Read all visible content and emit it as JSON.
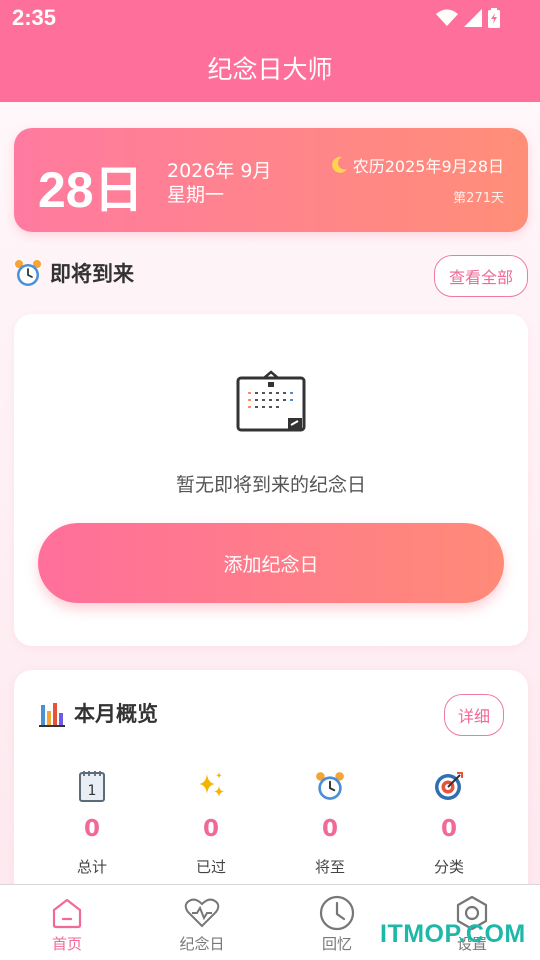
{
  "status_bar": {
    "time": "2:35"
  },
  "header": {
    "title": "纪念日大师"
  },
  "date_card": {
    "day": "28日",
    "year_month": "2026年 9月",
    "weekday": "星期一",
    "lunar": "农历2025年9月28日",
    "day_of_year": "第271天"
  },
  "upcoming": {
    "title": "即将到来",
    "view_all": "查看全部",
    "empty_text": "暂无即将到来的纪念日",
    "add_button": "添加纪念日"
  },
  "overview": {
    "title": "本月概览",
    "detail_button": "详细",
    "stats": [
      {
        "icon": "calendar-icon",
        "value": "0",
        "label": "总计"
      },
      {
        "icon": "sparkle-icon",
        "value": "0",
        "label": "已过"
      },
      {
        "icon": "alarm-clock-icon",
        "value": "0",
        "label": "将至"
      },
      {
        "icon": "target-icon",
        "value": "0",
        "label": "分类"
      }
    ]
  },
  "bottom_nav": [
    {
      "label": "首页",
      "icon": "home-icon",
      "active": true
    },
    {
      "label": "纪念日",
      "icon": "heart-icon",
      "active": false
    },
    {
      "label": "回忆",
      "icon": "clock-icon",
      "active": false
    },
    {
      "label": "设置",
      "icon": "settings-icon",
      "active": false
    }
  ],
  "watermark": "ITMOP.COM",
  "colors": {
    "primary": "#ff6f9b",
    "gradient_end": "#ff8e78",
    "accent_text": "#f06a95",
    "background": "#fcf0f4"
  }
}
